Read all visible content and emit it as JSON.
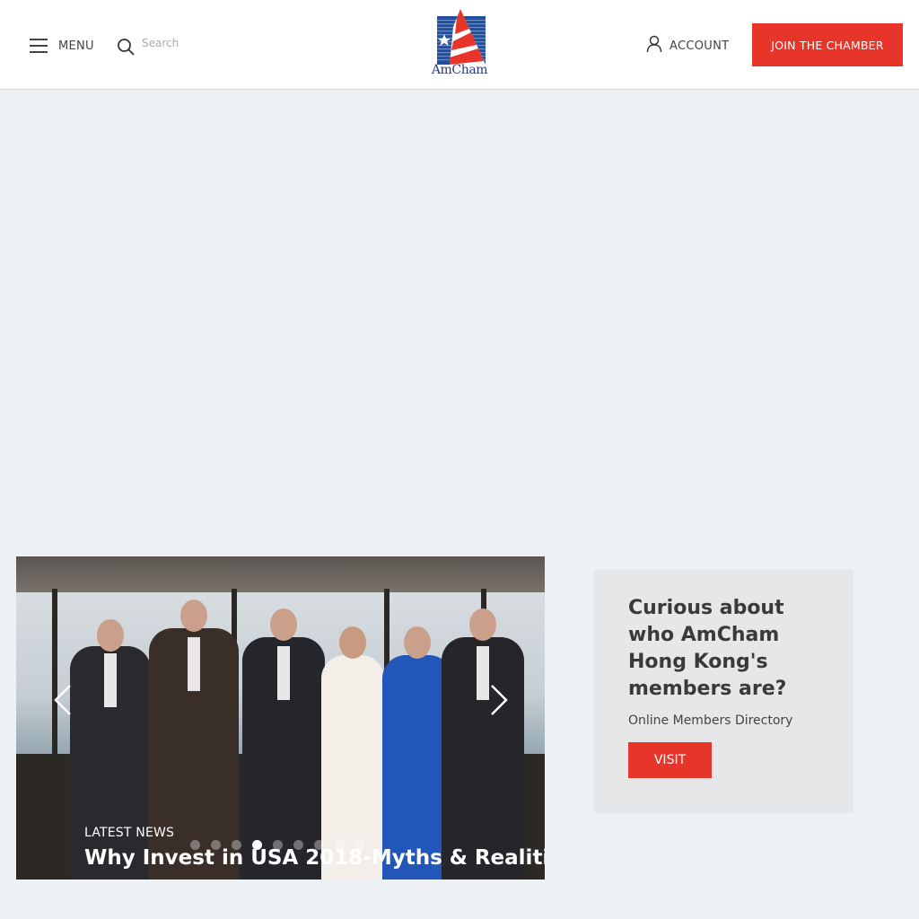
{
  "header": {
    "menu_label": "MENU",
    "search_placeholder": "Search",
    "logo_text": "AmCham",
    "account_label": "ACCOUNT",
    "join_label": "JOIN THE CHAMBER"
  },
  "slider": {
    "kicker": "LATEST NEWS",
    "title": "Why Invest in USA 2018-Myths & Realiti",
    "dot_count": 9,
    "active_dot": 3
  },
  "promo": {
    "title": "Curious about who AmCham Hong Kong's members are?",
    "subtitle": "Online Members Directory",
    "button_label": "VISIT"
  },
  "colors": {
    "accent": "#e8352a",
    "logo_blue": "#1f4fa0",
    "page_bg": "#eef1f4",
    "promo_bg": "#e6e7e9"
  }
}
